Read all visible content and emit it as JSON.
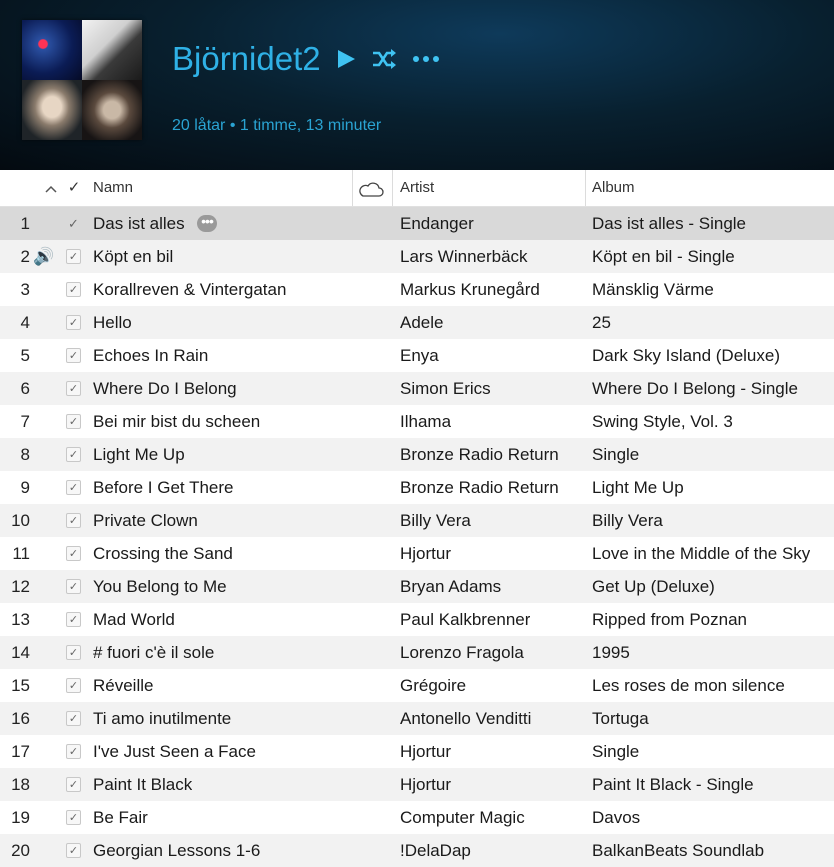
{
  "playlist": {
    "title": "Björnidet2",
    "subtitle": "20 låtar • 1 timme, 13 minuter",
    "play_icon": "play-icon",
    "shuffle_icon": "shuffle-icon",
    "more_icon": "more-icon"
  },
  "columns": {
    "sort_indicator": "^",
    "check": "✓",
    "name": "Namn",
    "cloud_icon": "cloud-icon",
    "artist": "Artist",
    "album": "Album"
  },
  "tracks": [
    {
      "num": "1",
      "name": "Das ist alles",
      "artist": "Endanger",
      "album": "Das ist alles - Single",
      "selected": true,
      "more": "•••"
    },
    {
      "num": "2",
      "name": "Köpt en bil",
      "artist": "Lars Winnerbäck",
      "album": "Köpt en bil - Single",
      "playing": true,
      "speaker": "🔊"
    },
    {
      "num": "3",
      "name": "Korallreven & Vintergatan",
      "artist": "Markus Krunegård",
      "album": "Mänsklig Värme"
    },
    {
      "num": "4",
      "name": "Hello",
      "artist": "Adele",
      "album": "25"
    },
    {
      "num": "5",
      "name": "Echoes In Rain",
      "artist": "Enya",
      "album": "Dark Sky Island (Deluxe)"
    },
    {
      "num": "6",
      "name": "Where Do I Belong",
      "artist": "Simon Erics",
      "album": "Where Do I Belong - Single"
    },
    {
      "num": "7",
      "name": "Bei mir bist du scheen",
      "artist": "Ilhama",
      "album": "Swing Style, Vol. 3"
    },
    {
      "num": "8",
      "name": "Light Me Up",
      "artist": "Bronze Radio Return",
      "album": "Single"
    },
    {
      "num": "9",
      "name": "Before I Get There",
      "artist": "Bronze Radio Return",
      "album": "Light Me Up"
    },
    {
      "num": "10",
      "name": "Private Clown",
      "artist": "Billy Vera",
      "album": "Billy Vera"
    },
    {
      "num": "11",
      "name": "Crossing the Sand",
      "artist": "Hjortur",
      "album": "Love in the Middle of the Sky"
    },
    {
      "num": "12",
      "name": "You Belong to Me",
      "artist": "Bryan Adams",
      "album": "Get Up (Deluxe)"
    },
    {
      "num": "13",
      "name": "Mad World",
      "artist": "Paul Kalkbrenner",
      "album": "Ripped from Poznan"
    },
    {
      "num": "14",
      "name": "# fuori c'è il sole",
      "artist": "Lorenzo Fragola",
      "album": "1995"
    },
    {
      "num": "15",
      "name": "Réveille",
      "artist": "Grégoire",
      "album": "Les roses de mon silence"
    },
    {
      "num": "16",
      "name": "Ti amo inutilmente",
      "artist": "Antonello Venditti",
      "album": "Tortuga"
    },
    {
      "num": "17",
      "name": "I've Just Seen a Face",
      "artist": "Hjortur",
      "album": "Single"
    },
    {
      "num": "18",
      "name": "Paint It Black",
      "artist": "Hjortur",
      "album": "Paint It Black - Single"
    },
    {
      "num": "19",
      "name": "Be Fair",
      "artist": "Computer Magic",
      "album": "Davos"
    },
    {
      "num": "20",
      "name": "Georgian Lessons 1-6",
      "artist": "!DelaDap",
      "album": "BalkanBeats Soundlab"
    }
  ],
  "colors": {
    "accent": "#2fb1e6",
    "header_bg": "#08202f",
    "row_alt": "#f2f2f2",
    "row_selected": "#d9d9d9"
  }
}
